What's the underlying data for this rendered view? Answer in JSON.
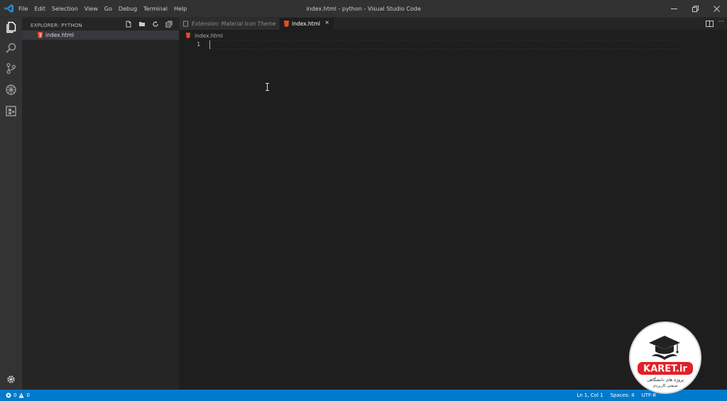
{
  "titlebar": {
    "menu": [
      "File",
      "Edit",
      "Selection",
      "View",
      "Go",
      "Debug",
      "Terminal",
      "Help"
    ],
    "title": "index.html - python - Visual Studio Code",
    "controls": [
      "minimize-icon",
      "restore-icon",
      "close-icon"
    ]
  },
  "activitybar": {
    "items": [
      "explorer-icon",
      "search-icon",
      "source-control-icon",
      "debug-icon",
      "extensions-icon"
    ],
    "bottom": "gear-icon"
  },
  "sidebar": {
    "header": "EXPLORER: PYTHON",
    "tools": [
      "new-file-icon",
      "new-folder-icon",
      "refresh-icon",
      "collapse-all-icon"
    ],
    "files": [
      {
        "name": "index.html",
        "icon": "html-file-icon"
      }
    ]
  },
  "tabs": [
    {
      "label": "Extension: Material Icon Theme",
      "active": false
    },
    {
      "label": "index.html",
      "active": true,
      "close": "×"
    }
  ],
  "breadcrumb": {
    "file": "index.html"
  },
  "editor": {
    "line_numbers": [
      "1"
    ]
  },
  "statusbar": {
    "errors": "0",
    "warnings": "0",
    "position": "Ln 1, Col 1",
    "spaces": "Spaces: 4",
    "encoding": "UTF-8"
  },
  "watermark": {
    "brand": "KARET.ir",
    "tagline_1": "پروژه های دانشگاهی",
    "tagline_2": "صنعتی کاربردی"
  },
  "colors": {
    "accent": "#007acc",
    "titlebar": "#323233",
    "activitybar": "#333333",
    "sidebar": "#252526",
    "editor": "#1e1e1e",
    "html_icon": "#e44d26"
  }
}
